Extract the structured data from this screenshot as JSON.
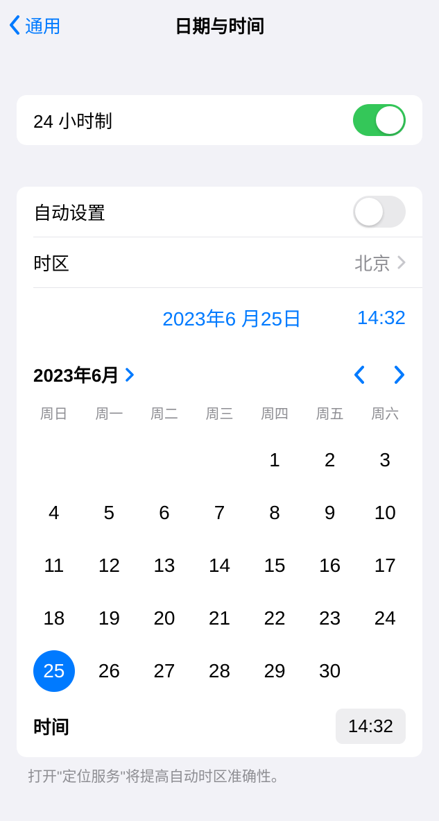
{
  "header": {
    "back_label": "通用",
    "title": "日期与时间"
  },
  "settings": {
    "twenty_four_hour_label": "24 小时制",
    "twenty_four_hour_on": true,
    "auto_set_label": "自动设置",
    "auto_set_on": false,
    "timezone_label": "时区",
    "timezone_value": "北京"
  },
  "datetime": {
    "date_display": "2023年6 月25日",
    "time_display": "14:32"
  },
  "calendar": {
    "month_year": "2023年6月",
    "weekdays": [
      "周日",
      "周一",
      "周二",
      "周三",
      "周四",
      "周五",
      "周六"
    ],
    "first_weekday": 4,
    "days_in_month": 30,
    "selected_day": 25,
    "time_label": "时间",
    "time_value": "14:32"
  },
  "footer": {
    "text": "打开\"定位服务\"将提高自动时区准确性。"
  }
}
